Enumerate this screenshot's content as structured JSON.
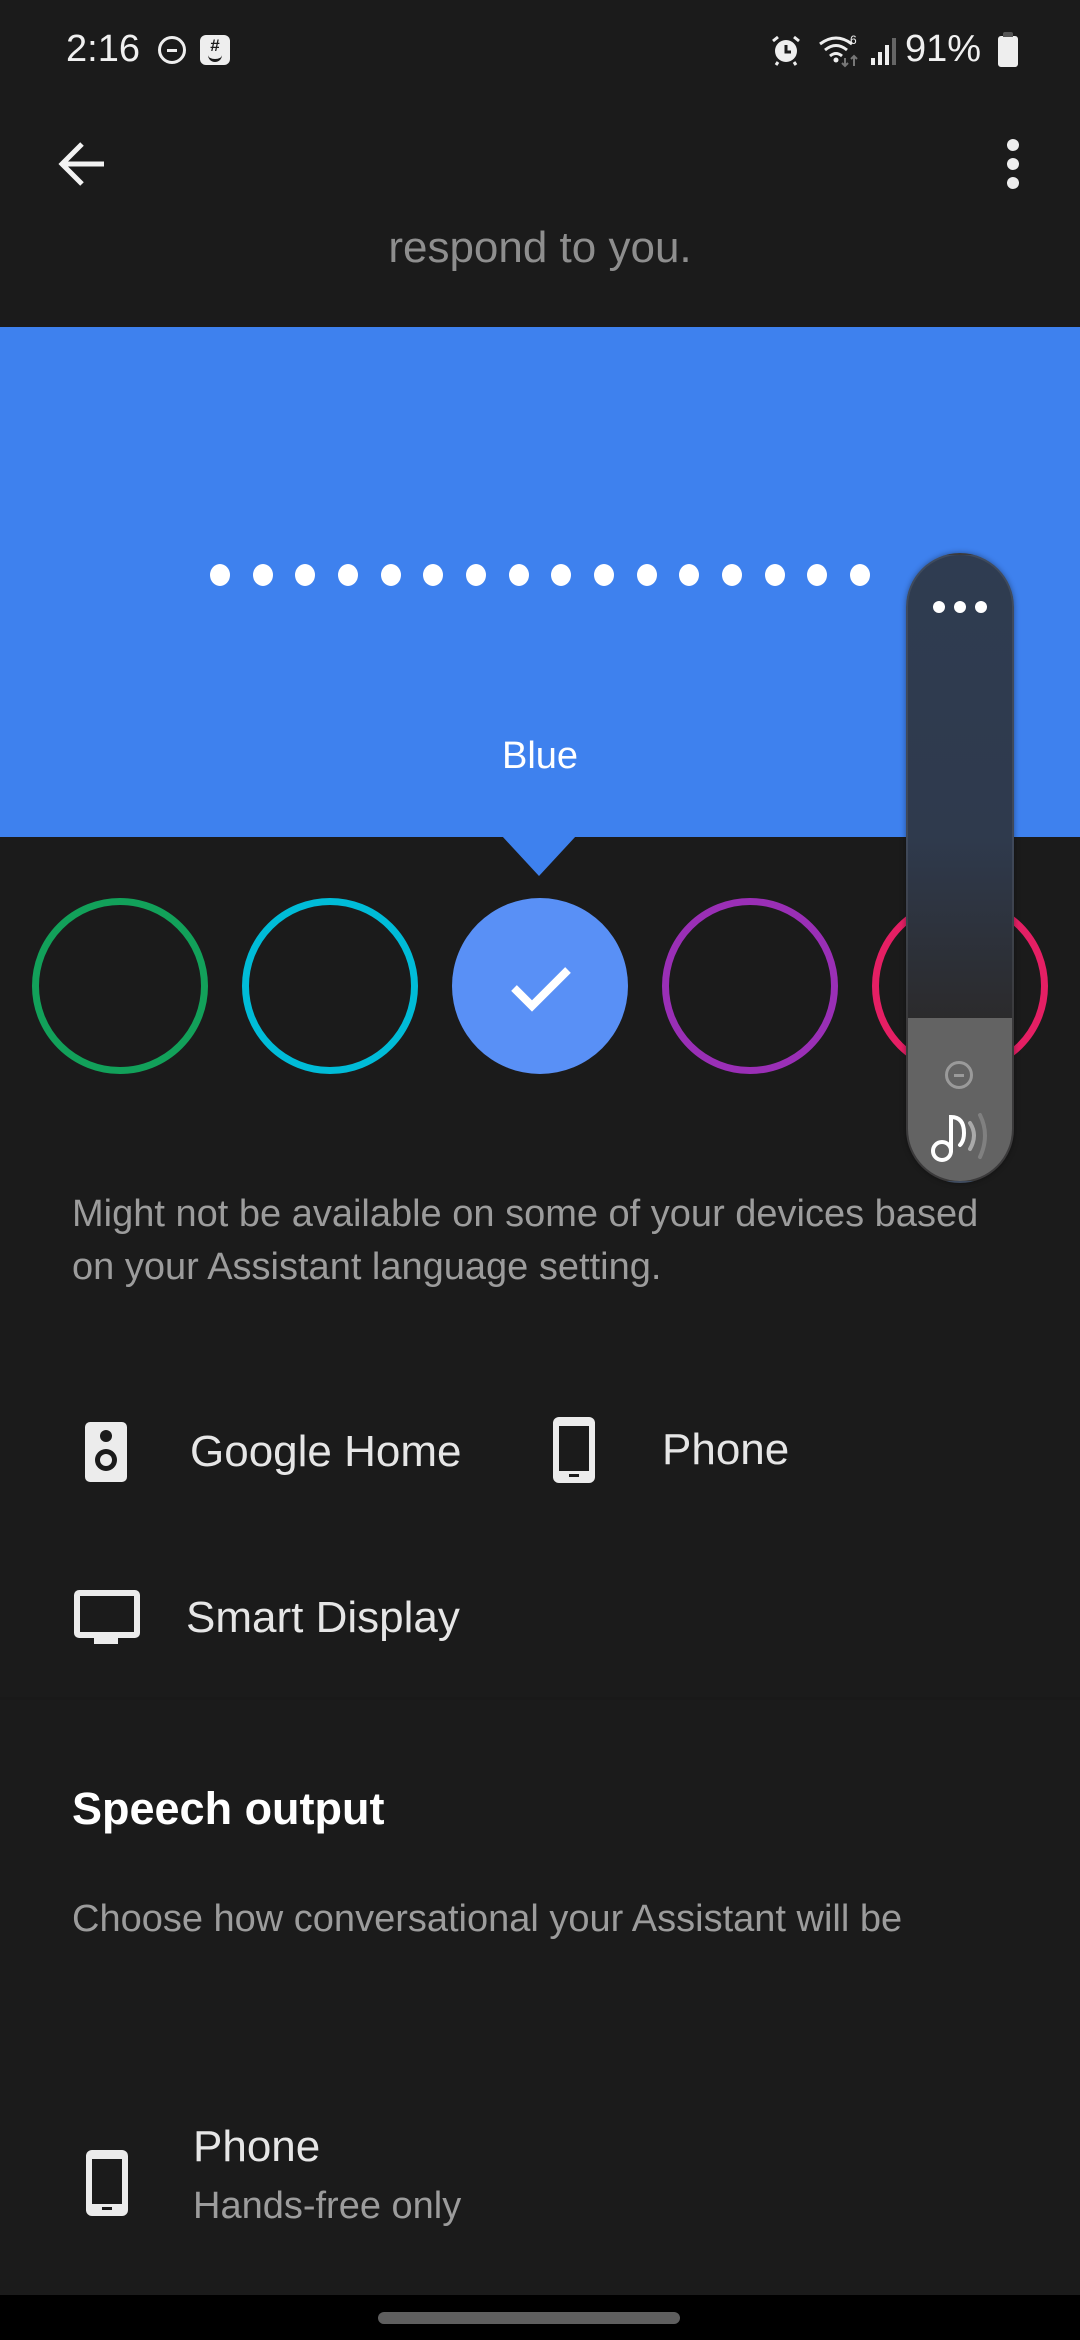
{
  "status_bar": {
    "time": "2:16",
    "battery_percent": "91%",
    "icons": [
      "do-not-disturb-icon",
      "groupme-icon",
      "alarm-icon",
      "wifi-6-icon",
      "cell-signal-icon",
      "battery-icon"
    ]
  },
  "app_bar": {
    "back_icon": "arrow-back-icon",
    "more_icon": "more-vert-icon"
  },
  "intro_text_partial": "respond to you.",
  "voice_preview": {
    "voice_name": "Blue",
    "background_color": "#3e81ee",
    "dot_count": 16
  },
  "voice_swatches": [
    {
      "name": "green",
      "color": "#12a15a",
      "selected": false
    },
    {
      "name": "cyan",
      "color": "#00bcd8",
      "selected": false
    },
    {
      "name": "blue",
      "color": "#5990f6",
      "selected": true
    },
    {
      "name": "purple",
      "color": "#9a2fb6",
      "selected": false
    },
    {
      "name": "pink",
      "color": "#e51f64",
      "selected": false
    }
  ],
  "volume_overlay": {
    "level_fraction": 0.26,
    "more_icon": "more-horiz-icon",
    "mute_icon": "minus-circle-icon",
    "stream_icon": "media-volume-icon"
  },
  "availability_note": "Might not be available on some of your devices based on your Assistant language setting.",
  "devices": [
    {
      "icon": "speaker-icon",
      "label": "Google Home"
    },
    {
      "icon": "smartphone-icon",
      "label": "Phone"
    },
    {
      "icon": "smart-display-icon",
      "label": "Smart Display"
    }
  ],
  "speech_output": {
    "title": "Speech output",
    "description": "Choose how conversational your Assistant will be",
    "item": {
      "icon": "smartphone-icon",
      "title": "Phone",
      "subtitle": "Hands-free only"
    }
  }
}
